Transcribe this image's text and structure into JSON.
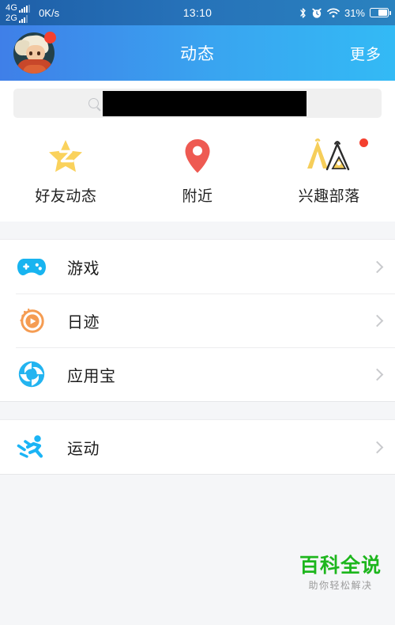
{
  "statusbar": {
    "network_primary": "4G",
    "network_secondary": "2G",
    "speed": "0K/s",
    "time": "13:10",
    "battery_percent": "31%",
    "icons": [
      "bluetooth-icon",
      "alarm-icon",
      "wifi-icon",
      "battery-icon"
    ]
  },
  "header": {
    "title": "动态",
    "more_label": "更多",
    "avatar_name": "user-avatar",
    "has_notification_dot": true,
    "gradient_from": "#3f7fe8",
    "gradient_to": "#33baf5"
  },
  "search": {
    "placeholder": "",
    "icon": "search-icon",
    "redacted": true
  },
  "shortcuts": [
    {
      "label": "好友动态",
      "icon": "qzone-star-icon",
      "color": "#fad25c",
      "badge": false
    },
    {
      "label": "附近",
      "icon": "location-pin-icon",
      "color": "#ee5a52",
      "badge": false
    },
    {
      "label": "兴趣部落",
      "icon": "tent-tribe-icon",
      "color": "#f6ce5a",
      "badge": true
    }
  ],
  "groups": [
    {
      "rows": [
        {
          "label": "游戏",
          "icon": "gamepad-icon",
          "color": "#18b4f0"
        },
        {
          "label": "日迹",
          "icon": "play-circle-icon",
          "color": "#f59c52"
        },
        {
          "label": "应用宝",
          "icon": "myapp-pinwheel-icon",
          "color": "#23b4f0"
        }
      ]
    },
    {
      "rows": [
        {
          "label": "运动",
          "icon": "running-person-icon",
          "color": "#1bb4f5"
        }
      ]
    }
  ],
  "watermark": {
    "main": "百科全说",
    "sub": "助你轻松解决",
    "color": "#1db61d"
  }
}
